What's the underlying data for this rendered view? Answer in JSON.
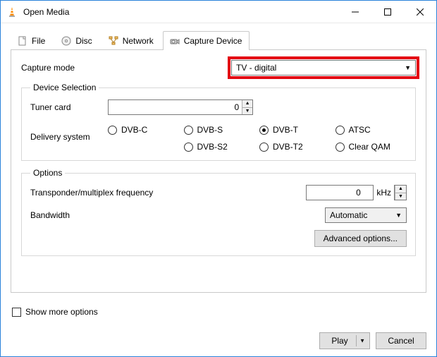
{
  "window": {
    "title": "Open Media"
  },
  "tabs": {
    "file": "File",
    "disc": "Disc",
    "network": "Network",
    "capture": "Capture Device"
  },
  "captureMode": {
    "label": "Capture mode",
    "value": "TV - digital"
  },
  "deviceSelection": {
    "legend": "Device Selection",
    "tunerCard": {
      "label": "Tuner card",
      "value": "0"
    },
    "deliverySystem": {
      "label": "Delivery system",
      "options": {
        "dvbc": "DVB-C",
        "dvbs": "DVB-S",
        "dvbt": "DVB-T",
        "atsc": "ATSC",
        "dvbs2": "DVB-S2",
        "dvbt2": "DVB-T2",
        "clearqam": "Clear QAM"
      },
      "selected": "dvbt"
    }
  },
  "options": {
    "legend": "Options",
    "frequency": {
      "label": "Transponder/multiplex frequency",
      "value": "0",
      "unit": "kHz"
    },
    "bandwidth": {
      "label": "Bandwidth",
      "value": "Automatic"
    },
    "advanced": "Advanced options..."
  },
  "showMoreOptions": "Show more options",
  "footer": {
    "play": "Play",
    "cancel": "Cancel"
  }
}
